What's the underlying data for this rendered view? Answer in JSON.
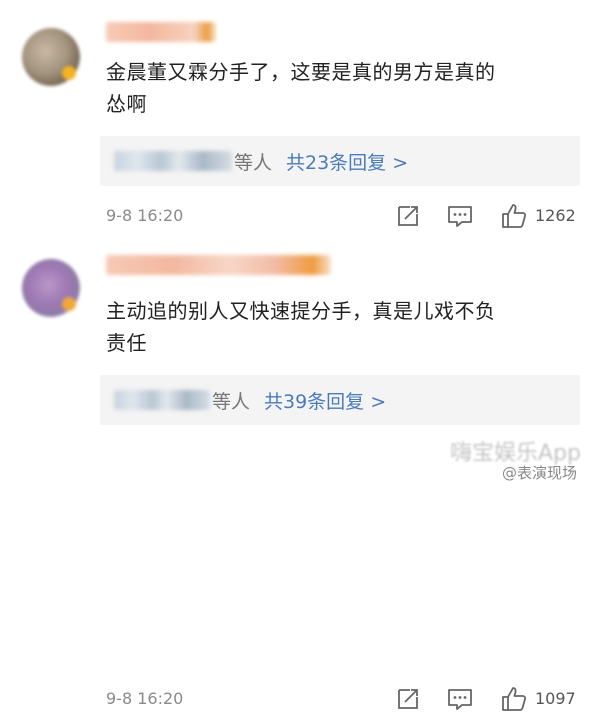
{
  "comments": [
    {
      "text_line1": "金晨董又霖分手了，这要是真的男方是真的",
      "text_line2": "怂啊",
      "reply_suffix": "等人",
      "reply_count": "共23条回复 >",
      "timestamp": "9-8 16:20",
      "likes": "1262"
    },
    {
      "text_line1": "主动追的别人又快速提分手，真是儿戏不负",
      "text_line2": "责任",
      "reply_suffix": "等人",
      "reply_count": "共39条回复 >",
      "timestamp": "9-8 16:20",
      "likes": "1097"
    }
  ],
  "watermark": {
    "blurred_text": "嗨宝娱乐App",
    "text": "@表演现场"
  },
  "colors": {
    "link": "#4a7bbd",
    "reply_bg": "#f4f4f4",
    "meta": "#8a8a8a"
  }
}
